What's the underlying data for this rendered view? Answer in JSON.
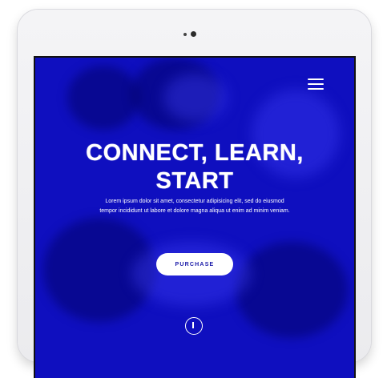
{
  "hero": {
    "title_line1": "CONNECT, LEARN,",
    "title_line2": "START",
    "description": "Lorem ipsum dolor sit amet, consectetur adipisicing elit, sed do eiusmod tempor incididunt ut labore et dolore magna aliqua ut enim ad minim veniam.",
    "purchase_label": "PURCHASE"
  },
  "icons": {
    "menu": "hamburger-menu-icon",
    "scroll": "scroll-down-icon"
  },
  "colors": {
    "hero_background": "#0f0fbf",
    "button_text": "#1a1aa8",
    "device_frame": "#efeff2"
  }
}
